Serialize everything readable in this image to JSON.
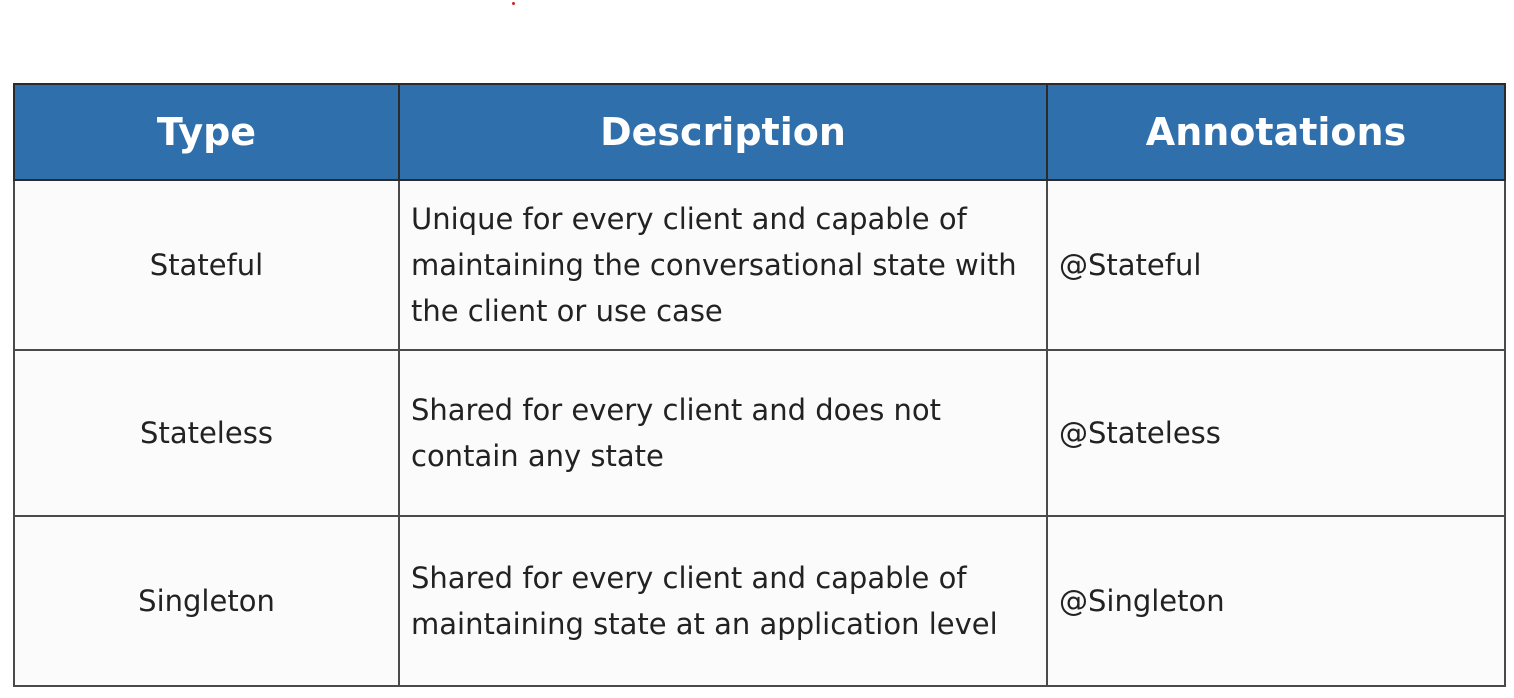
{
  "table": {
    "headers": {
      "type": "Type",
      "description": "Description",
      "annotations": "Annotations"
    },
    "rows": [
      {
        "type": "Stateful",
        "description": "Unique for every client and capable of maintaining the conversational state with the client or use case",
        "annotation": "@Stateful"
      },
      {
        "type": "Stateless",
        "description": "Shared for every client and does not contain any state",
        "annotation": "@Stateless"
      },
      {
        "type": "Singleton",
        "description": "Shared for every client and capable of maintaining state at an application level",
        "annotation": "@Singleton"
      }
    ]
  },
  "colors": {
    "header_background": "#2f6fac",
    "header_text": "#ffffff",
    "body_text": "#222222",
    "grid_line": "#4a4a4a"
  }
}
